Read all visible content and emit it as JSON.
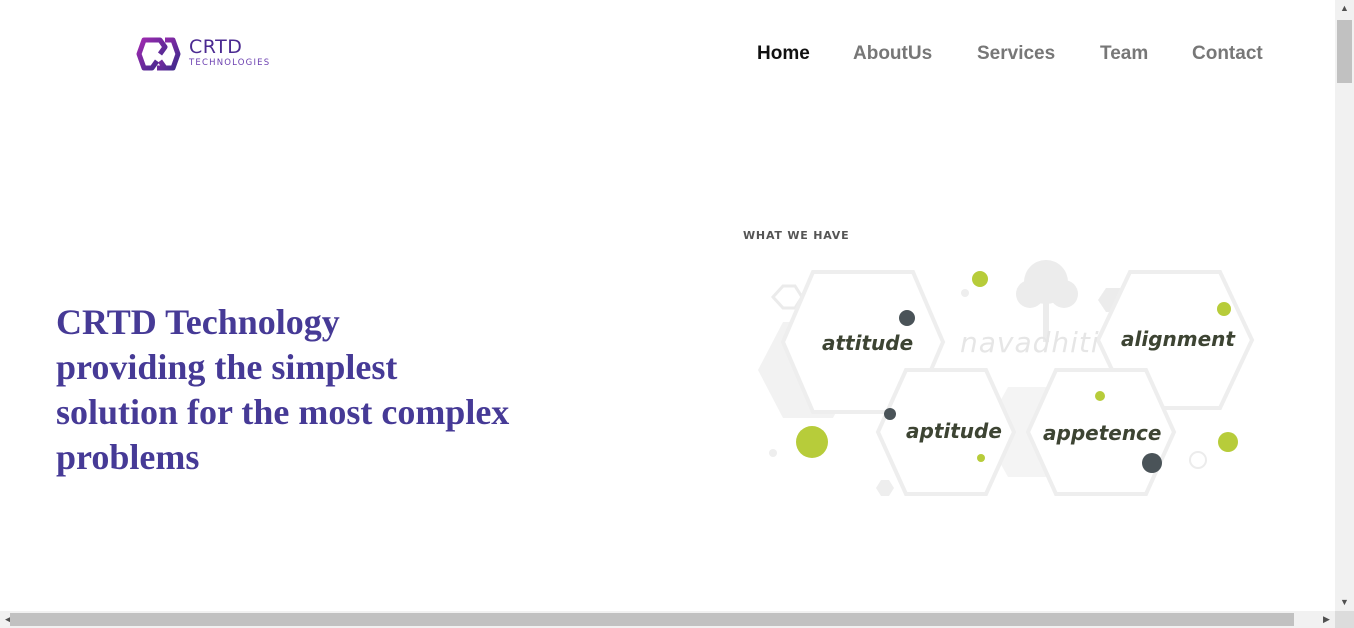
{
  "brand": {
    "name": "CRTD",
    "subtitle": "TECHNOLOGIES",
    "colors": {
      "primary": "#4b2a91",
      "accent": "#a02ab0"
    }
  },
  "nav": {
    "items": [
      {
        "label": "Home",
        "active": true
      },
      {
        "label": "AboutUs",
        "active": false
      },
      {
        "label": "Services",
        "active": false
      },
      {
        "label": "Team",
        "active": false
      },
      {
        "label": "Contact",
        "active": false
      }
    ]
  },
  "hero": {
    "line1": "CRTD Technology",
    "line2": "providing the simplest",
    "line3": "solution for the most complex",
    "line4": "problems",
    "color": "#463a96"
  },
  "illustration": {
    "heading": "WHAT WE HAVE",
    "watermark": "navadhiti",
    "words": [
      "attitude",
      "alignment",
      "aptitude",
      "appetence"
    ],
    "dot_colors": {
      "green": "#b7cc3a",
      "dark": "#4a5358"
    }
  }
}
